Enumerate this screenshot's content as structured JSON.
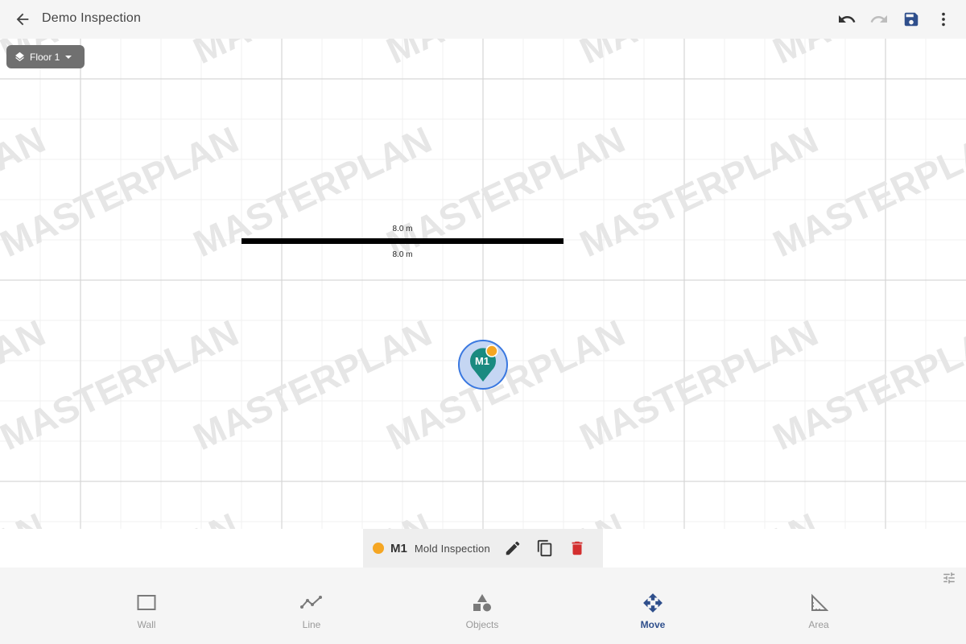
{
  "appbar": {
    "title": "Demo Inspection",
    "icons": [
      "arrow-back-icon",
      "undo-icon",
      "redo-icon",
      "save-icon",
      "more-vert-icon"
    ]
  },
  "floor": {
    "label": "Floor 1"
  },
  "canvas": {
    "watermark": "MASTERPLAN",
    "wall": {
      "length_label_top": "8.0 m",
      "length_label_bottom": "8.0 m"
    },
    "marker": {
      "code": "M1"
    }
  },
  "selection": {
    "code": "M1",
    "name": "Mold Inspection",
    "status_color": "#f5a623",
    "icons": [
      "edit-icon",
      "copy-icon",
      "delete-icon"
    ]
  },
  "bottom_nav": {
    "items": [
      {
        "label": "Wall",
        "icon": "wall-icon",
        "active": false
      },
      {
        "label": "Line",
        "icon": "line-icon",
        "active": false
      },
      {
        "label": "Objects",
        "icon": "objects-icon",
        "active": false
      },
      {
        "label": "Move",
        "icon": "move-icon",
        "active": true
      },
      {
        "label": "Area",
        "icon": "area-icon",
        "active": false
      }
    ]
  },
  "colors": {
    "accent": "#2f4f8c",
    "marker_teal": "#1a8a80",
    "delete_red": "#d32f2f",
    "status_orange": "#f5a623"
  }
}
